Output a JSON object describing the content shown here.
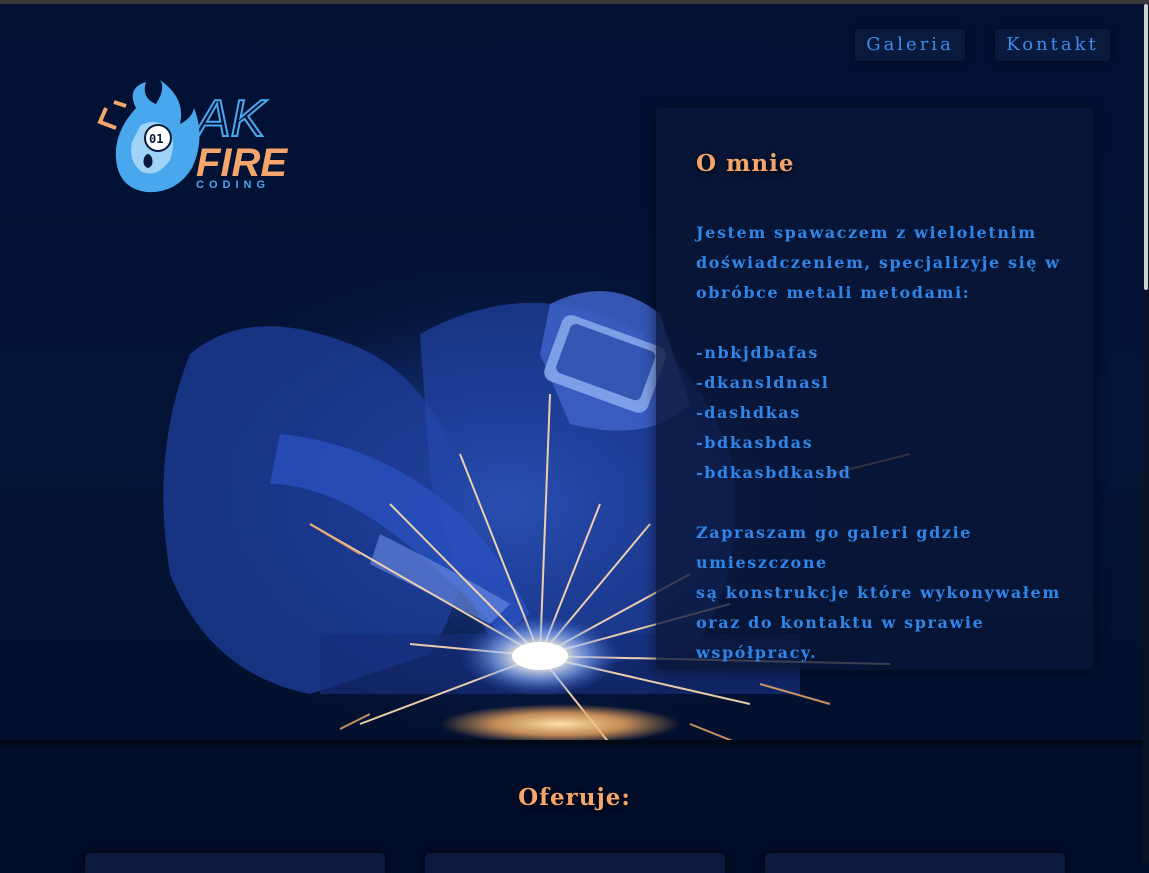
{
  "nav": {
    "galeria": "Galeria",
    "kontakt": "Kontakt"
  },
  "logo": {
    "text_main": "AK",
    "text_fire": "FIRE",
    "text_sub": "CODING",
    "binary": "01"
  },
  "about": {
    "title": "O mnie",
    "intro": [
      "Jestem spawaczem z wieloletnim",
      "doświadczeniem, specjalizyje się w",
      "obróbce metali metodami:"
    ],
    "methods": [
      "-nbkjdbafas",
      "-dkansldnasl",
      "-dashdkas",
      "-bdkasbdas",
      "-bdkasbdkasbd"
    ],
    "outro": [
      "Zapraszam go galeri gdzie umieszczone",
      "są konstrukcje które wykonywałem",
      "oraz do kontaktu w sprawie",
      "współpracy."
    ]
  },
  "offer": {
    "title": "Oferuje:"
  },
  "colors": {
    "background": "#020d2a",
    "accent_orange": "#f3a56b",
    "accent_blue": "#2f86e8"
  }
}
